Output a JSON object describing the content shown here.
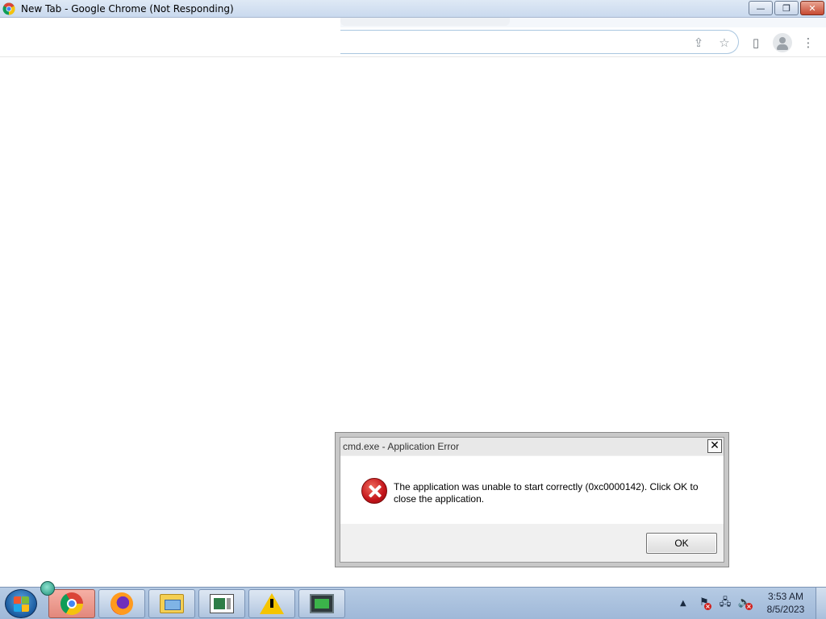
{
  "window": {
    "title": "New Tab - Google Chrome (Not Responding)",
    "minimize_glyph": "—",
    "maximize_glyph": "❐",
    "close_glyph": "✕"
  },
  "browser": {
    "share_icon": "share-icon",
    "bookmark_icon": "bookmark-star-icon",
    "side_panel_icon": "side-panel-icon",
    "profile_icon": "profile-icon",
    "menu_icon": "kebab-menu-icon"
  },
  "dialog": {
    "title": "cmd.exe - Application Error",
    "close_glyph": "✕",
    "message": "The application was unable to start correctly (0xc0000142). Click OK to close the application.",
    "ok_label": "OK",
    "icon": "error-icon"
  },
  "taskbar": {
    "items": [
      {
        "name": "chrome",
        "active": true
      },
      {
        "name": "firefox",
        "active": false
      },
      {
        "name": "file-explorer",
        "active": false
      },
      {
        "name": "news-app",
        "active": false
      },
      {
        "name": "warning-app",
        "active": false
      },
      {
        "name": "monitor-app",
        "active": false
      }
    ],
    "tray": {
      "show_hidden_glyph": "▲",
      "clock_time": "3:53 AM",
      "clock_date": "8/5/2023"
    }
  },
  "colors": {
    "accent_error": "#c4141a",
    "taskbar": "#b6cbe4",
    "titlebar": "#dfe9f5"
  }
}
